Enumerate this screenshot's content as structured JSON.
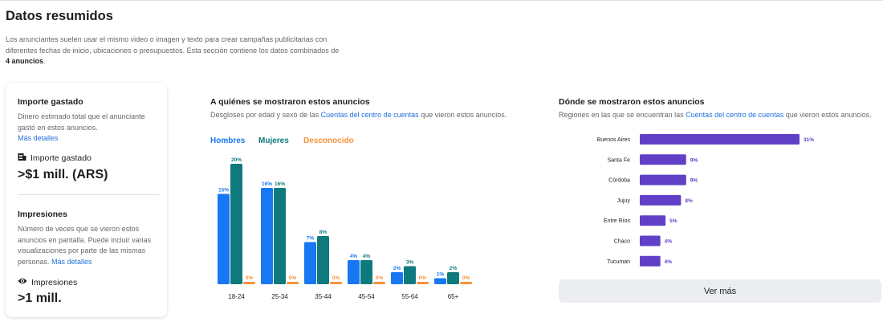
{
  "header": {
    "title": "Datos resumidos"
  },
  "intro": {
    "text_before": "Los anunciantes suelen usar el mismo video o imagen y texto para crear campañas publicitarias con diferentes fechas de inicio, ubicaciones o presupuestos. Esta sección contiene los datos combinados de ",
    "count": "4 anuncios",
    "text_after": "."
  },
  "summary_card": {
    "spend": {
      "heading": "Importe gastado",
      "description": "Dinero estimado total que el anunciante gastó en estos anuncios.",
      "more_link": "Más detalles",
      "metric_label": "Importe gastado",
      "metric_icon": "receipt-icon",
      "metric_value": ">$1 mill. (ARS)"
    },
    "impressions": {
      "heading": "Impresiones",
      "description": "Número de veces que se vieron estos anuncios en pantalla. Puede incluir varias visualizaciones por parte de las mismas personas. ",
      "more_link": "Más detalles",
      "metric_label": "Impresiones",
      "metric_icon": "eye-icon",
      "metric_value": ">1 mill."
    }
  },
  "audience": {
    "title": "A quiénes se mostraron estos anuncios",
    "subtitle_before": "Desgloses por edad y sexo de las ",
    "subtitle_link": "Cuentas del centro de cuentas",
    "subtitle_after": " que vieron estos anuncios."
  },
  "regions": {
    "title": "Dónde se mostraron estos anuncios",
    "subtitle_before": "Regiones en las que se encuentran las ",
    "subtitle_link": "Cuentas del centro de cuentas",
    "subtitle_after": " que vieron estos anuncios.",
    "see_more": "Ver más"
  },
  "colors": {
    "men": "#1877f2",
    "women": "#0e7a7e",
    "unknown": "#f7923a",
    "region": "#6040c7",
    "link": "#216fdb"
  },
  "chart_data": [
    {
      "type": "bar",
      "categories": [
        "18-24",
        "25-34",
        "35-44",
        "45-54",
        "55-64",
        "65+"
      ],
      "series": [
        {
          "name": "Hombres",
          "values": [
            15,
            16,
            7,
            4,
            2,
            1
          ]
        },
        {
          "name": "Mujeres",
          "values": [
            20,
            16,
            8,
            4,
            3,
            2
          ]
        },
        {
          "name": "Desconocido",
          "values": [
            0,
            0,
            0,
            0,
            0,
            0
          ]
        }
      ],
      "ylim": [
        0,
        20
      ],
      "value_suffix": "%",
      "legend": "top-left"
    },
    {
      "type": "bar",
      "orientation": "horizontal",
      "categories": [
        "Buenos Aires",
        "Santa Fe",
        "Córdoba",
        "Jujuy",
        "Entre Ríos",
        "Chaco",
        "Tucuman"
      ],
      "values": [
        31,
        9,
        9,
        8,
        5,
        4,
        4
      ],
      "xlim": [
        0,
        31
      ],
      "value_suffix": "%"
    }
  ]
}
